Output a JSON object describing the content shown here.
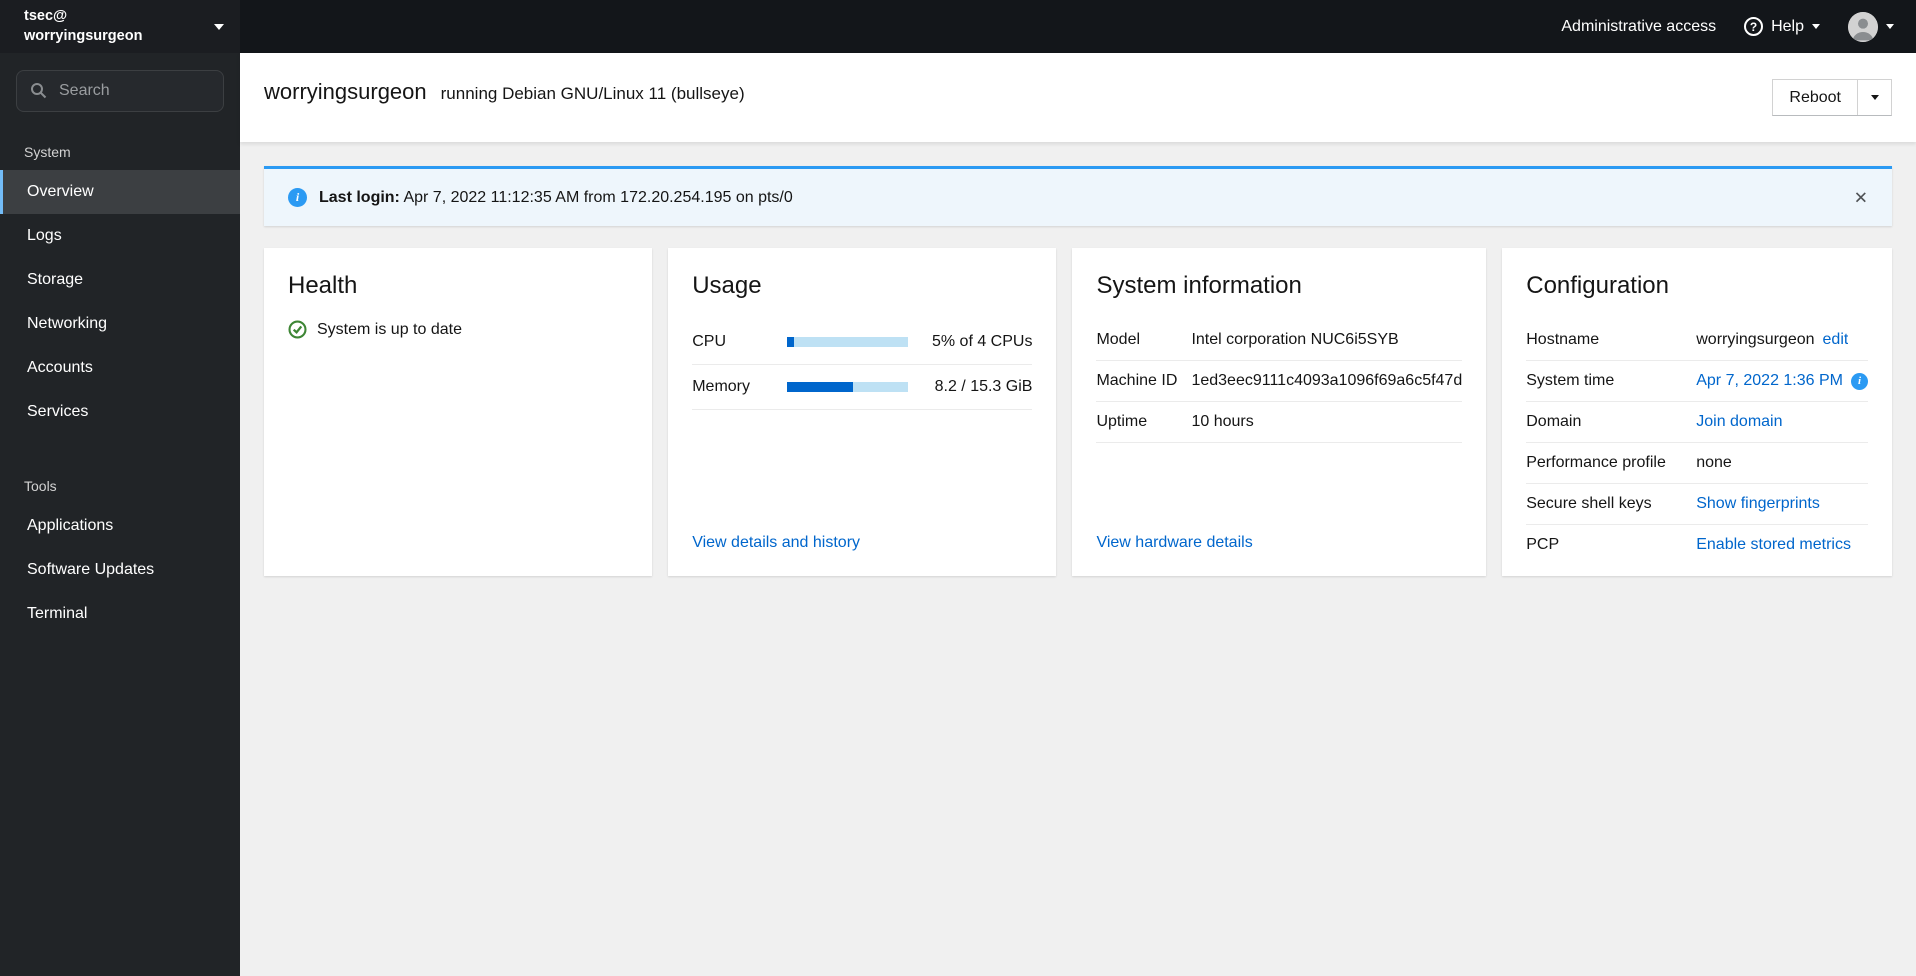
{
  "masthead": {
    "admin_access_label": "Administrative access",
    "help_label": "Help"
  },
  "sidebar": {
    "user": "tsec@",
    "hostname": "worryingsurgeon",
    "search_placeholder": "Search",
    "sections": [
      {
        "label": "System",
        "items": [
          {
            "label": "Overview"
          },
          {
            "label": "Logs"
          },
          {
            "label": "Storage"
          },
          {
            "label": "Networking"
          },
          {
            "label": "Accounts"
          },
          {
            "label": "Services"
          }
        ]
      },
      {
        "label": "Tools",
        "items": [
          {
            "label": "Applications"
          },
          {
            "label": "Software Updates"
          },
          {
            "label": "Terminal"
          }
        ]
      }
    ]
  },
  "page_header": {
    "hostname": "worryingsurgeon",
    "os_text": "running Debian GNU/Linux 11 (bullseye)",
    "reboot_label": "Reboot"
  },
  "alert": {
    "title": "Last login:",
    "message": "Apr 7, 2022 11:12:35 AM from 172.20.254.195 on pts/0"
  },
  "cards": {
    "health": {
      "title": "Health",
      "status": "System is up to date"
    },
    "usage": {
      "title": "Usage",
      "rows": [
        {
          "label": "CPU",
          "value": "5% of 4 CPUs",
          "percent": 6
        },
        {
          "label": "Memory",
          "value": "8.2 / 15.3 GiB",
          "percent": 54
        }
      ],
      "link": "View details and history"
    },
    "system_information": {
      "title": "System information",
      "rows": [
        {
          "label": "Model",
          "value": "Intel corporation NUC6i5SYB"
        },
        {
          "label": "Machine ID",
          "value": "1ed3eec9111c4093a1096f69a6c5f47d"
        },
        {
          "label": "Uptime",
          "value": "10 hours"
        }
      ],
      "link": "View hardware details"
    },
    "configuration": {
      "title": "Configuration",
      "rows": [
        {
          "label": "Hostname",
          "value": "worryingsurgeon",
          "action": "edit"
        },
        {
          "label": "System time",
          "link": "Apr 7, 2022 1:36 PM"
        },
        {
          "label": "Domain",
          "link": "Join domain"
        },
        {
          "label": "Performance profile",
          "value": "none"
        },
        {
          "label": "Secure shell keys",
          "link": "Show fingerprints"
        },
        {
          "label": "PCP",
          "link": "Enable stored metrics"
        }
      ]
    }
  },
  "icons": {
    "close": "✕",
    "help": "?",
    "info": "i"
  },
  "colors": {
    "link_blue": "#0066cc",
    "info_blue": "#2b9af3",
    "success_green": "#3e8635",
    "active_indicator": "#73bcf7",
    "progress_fill": "#0066cc",
    "progress_track": "#bee1f4",
    "sidebar_bg": "#212427",
    "masthead_bg": "#13161a"
  }
}
